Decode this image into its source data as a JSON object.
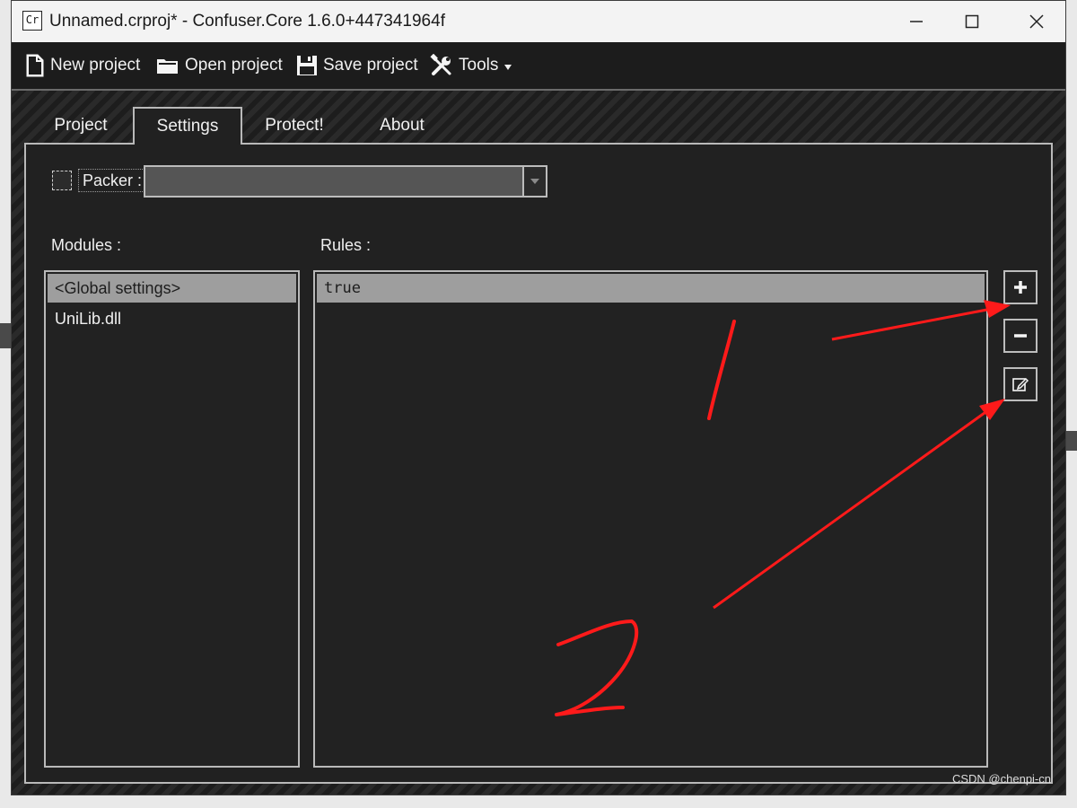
{
  "window": {
    "title": "Unnamed.crproj* - Confuser.Core 1.6.0+447341964f",
    "app_icon_text": "Cr"
  },
  "toolbar": {
    "new_project": "New project",
    "open_project": "Open project",
    "save_project": "Save project",
    "tools": "Tools"
  },
  "tabs": [
    {
      "label": "Project",
      "active": false
    },
    {
      "label": "Settings",
      "active": true
    },
    {
      "label": "Protect!",
      "active": false
    },
    {
      "label": "About",
      "active": false
    }
  ],
  "settings": {
    "packer_label": "Packer :",
    "packer_checked": false,
    "packer_value": "",
    "modules_label": "Modules :",
    "rules_label": "Rules :",
    "modules": [
      "<Global settings>",
      "UniLib.dll"
    ],
    "selected_module": 0,
    "rules": [
      "true"
    ],
    "selected_rule": 0
  },
  "annotations": [
    "1",
    "2"
  ],
  "watermark": "CSDN @chenpi-cn",
  "colors": {
    "window_bg": "#1f1f1f",
    "selection": "#9e9e9e",
    "annotation_red": "#ff1a1a"
  },
  "icons": {
    "new_project": "document-icon",
    "open_project": "folder-icon",
    "save_project": "floppy-icon",
    "tools": "tools-icon",
    "add_rule": "plus-icon",
    "remove_rule": "minus-icon",
    "edit_rule": "edit-icon"
  }
}
